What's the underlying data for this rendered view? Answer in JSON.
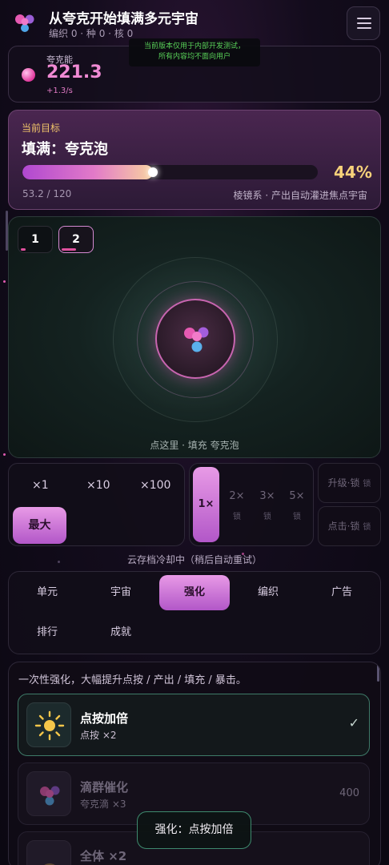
{
  "header": {
    "title": "从夸克开始填满多元宇宙",
    "stats": "编织 0 · 种 0 · 核 0",
    "dev_note_line1": "当前版本仅用于内部开发测试，",
    "dev_note_line2": "所有内容均不面向用户"
  },
  "energy": {
    "label": "夸克能",
    "value": "221.3",
    "rate": "+1.3/s"
  },
  "goal": {
    "label": "当前目标",
    "title": "填满：夸克泡",
    "progress_text": "53.2 / 120",
    "percent_text": "44%",
    "progress_fraction": 0.443,
    "hint": "棱镜系 · 产出自动灌进焦点宇宙"
  },
  "universe_tabs": [
    "1",
    "2"
  ],
  "arena": {
    "hint": "点这里 · 填充 夸克泡"
  },
  "buy": {
    "options": [
      "×1",
      "×10",
      "×100"
    ],
    "max_label": "最大"
  },
  "speed": {
    "active": "1×",
    "options": [
      "2×",
      "3×",
      "5×"
    ],
    "lock": "锁"
  },
  "side_buttons": {
    "upgrade": "升级·锁",
    "upgrade_icon": "lock-icon",
    "click": "点击·锁",
    "click_icon": "lock-icon",
    "upgrade_lock": "锁",
    "click_lock": "锁"
  },
  "cloud_status": "云存档冷却中（稍后自动重试）",
  "tabs": [
    "单元",
    "宇宙",
    "强化",
    "编织",
    "广告",
    "排行",
    "成就"
  ],
  "active_tab": "强化",
  "list": {
    "description": "一次性强化，大幅提升点按 / 产出 / 填充 / 暴击。",
    "items": [
      {
        "name": "点按加倍",
        "sub": "点按 ×2",
        "status": "✓",
        "icon": "sun-icon"
      },
      {
        "name": "滴群催化",
        "sub": "夸克滴 ×3",
        "cost": "400",
        "icon": "quark-cluster-icon"
      },
      {
        "name": "全体 ×2",
        "sub": "",
        "icon": "orb-icon"
      }
    ]
  },
  "toast": "强化：点按加倍",
  "colors": {
    "accent": "#e27ac8",
    "gold": "#f7d27a",
    "owned_border": "#3e7a68"
  }
}
